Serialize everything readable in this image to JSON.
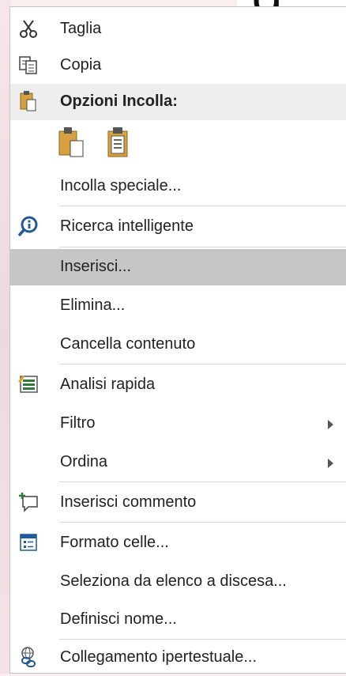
{
  "background": {
    "glyph": "g"
  },
  "menu": {
    "items": [
      {
        "label": "Taglia",
        "icon": "scissors-icon",
        "interactable": true
      },
      {
        "label": "Copia",
        "icon": "copy-icon",
        "interactable": true
      },
      {
        "label": "Opzioni Incolla:",
        "icon": "paste-icon",
        "interactable": false
      },
      {
        "label": "Incolla speciale...",
        "interactable": true
      },
      {
        "label": "Ricerca intelligente",
        "icon": "smart-lookup-icon",
        "interactable": true
      },
      {
        "label": "Inserisci...",
        "interactable": true,
        "highlighted": true
      },
      {
        "label": "Elimina...",
        "interactable": true
      },
      {
        "label": "Cancella contenuto",
        "interactable": true
      },
      {
        "label": "Analisi rapida",
        "icon": "quick-analysis-icon",
        "interactable": true
      },
      {
        "label": "Filtro",
        "submenu": true,
        "interactable": true
      },
      {
        "label": "Ordina",
        "submenu": true,
        "interactable": true
      },
      {
        "label": "Inserisci commento",
        "icon": "comment-icon",
        "interactable": true
      },
      {
        "label": "Formato celle...",
        "icon": "format-cells-icon",
        "interactable": true
      },
      {
        "label": "Seleziona da elenco a discesa...",
        "interactable": true
      },
      {
        "label": "Definisci nome...",
        "interactable": true
      },
      {
        "label": "Collegamento ipertestuale...",
        "icon": "hyperlink-icon",
        "interactable": true
      }
    ],
    "paste_options": [
      "paste-icon",
      "paste-values-icon"
    ]
  },
  "colors": {
    "highlight": "#c6c6c6",
    "header": "#eeeeee",
    "icon_blue": "#1f5a9a",
    "paste_gold": "#d8a040"
  }
}
